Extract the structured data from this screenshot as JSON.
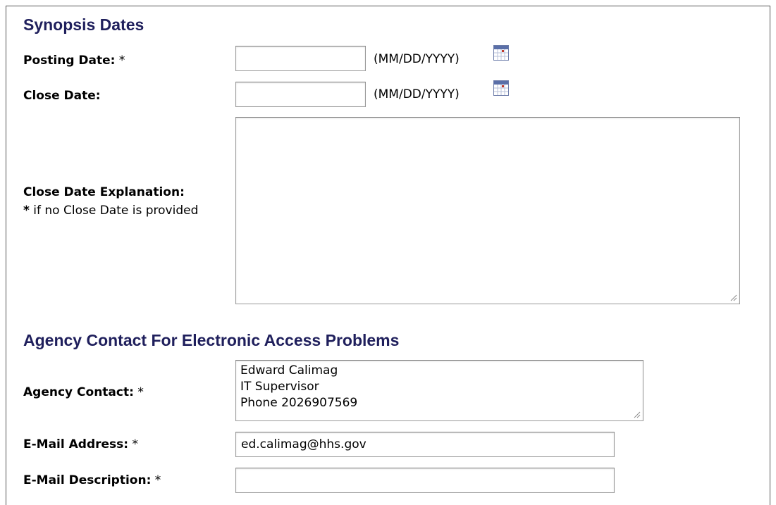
{
  "sections": {
    "synopsis_dates": {
      "title": "Synopsis Dates",
      "posting_date": {
        "label": "Posting Date:",
        "required_marker": "*",
        "value": "",
        "format_hint": "(MM/DD/YYYY)"
      },
      "close_date": {
        "label": "Close Date:",
        "value": "",
        "format_hint": "(MM/DD/YYYY)"
      },
      "close_date_explanation": {
        "label": "Close Date Explanation:",
        "note_marker": "*",
        "note_text": "if no Close Date is provided",
        "value": ""
      }
    },
    "agency_contact": {
      "title": "Agency Contact For Electronic Access Problems",
      "contact": {
        "label": "Agency Contact:",
        "required_marker": "*",
        "value": "Edward Calimag\nIT Supervisor\nPhone 2026907569"
      },
      "email_address": {
        "label": "E-Mail Address:",
        "required_marker": "*",
        "value": "ed.calimag@hhs.gov"
      },
      "email_description": {
        "label": "E-Mail Description:",
        "required_marker": "*",
        "value": ""
      }
    }
  },
  "icons": {
    "calendar": "calendar-icon",
    "resize": "resize-grip-icon"
  },
  "colors": {
    "heading": "#1f1f5c",
    "field_border": "#9a9a9a",
    "calendar_accent": "#c0392b"
  }
}
